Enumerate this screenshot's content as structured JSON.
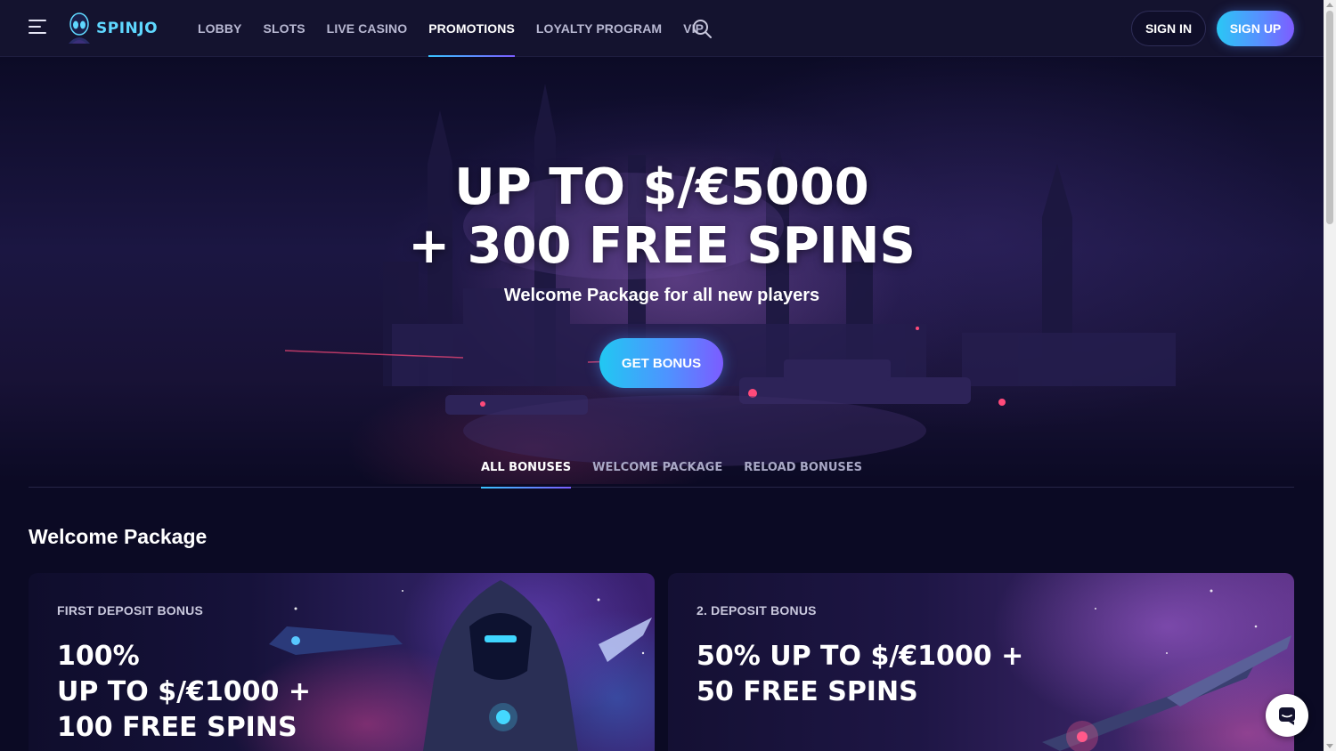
{
  "header": {
    "logo_text": "SPINJO",
    "nav": [
      {
        "label": "LOBBY"
      },
      {
        "label": "SLOTS"
      },
      {
        "label": "LIVE CASINO"
      },
      {
        "label": "PROMOTIONS",
        "active": true
      },
      {
        "label": "LOYALTY PROGRAM"
      },
      {
        "label": "VIP"
      }
    ],
    "sign_in": "SIGN IN",
    "sign_up": "SIGN UP"
  },
  "hero": {
    "title_line1": "UP TO $/€5000",
    "title_line2": "+ 300 FREE SPINS",
    "subtitle": "Welcome Package for all new players",
    "cta": "GET BONUS"
  },
  "tabs": [
    {
      "label": "ALL BONUSES",
      "active": true
    },
    {
      "label": "WELCOME PACKAGE"
    },
    {
      "label": "RELOAD BONUSES"
    }
  ],
  "section": {
    "title": "Welcome Package",
    "cards": [
      {
        "label": "FIRST DEPOSIT BONUS",
        "title": "100%\nUP TO $/€1000 +\n100 FREE SPINS"
      },
      {
        "label": "2. DEPOSIT BONUS",
        "title": "50% UP TO $/€1000 +\n50 FREE SPINS"
      }
    ]
  },
  "colors": {
    "background": "#0b0a24",
    "header_bg": "#14132f",
    "accent_cyan": "#2ac7f5",
    "accent_violet": "#7e5cff"
  },
  "icons": {
    "menu": "hamburger-icon",
    "search": "search-icon",
    "chat": "chat-icon"
  }
}
